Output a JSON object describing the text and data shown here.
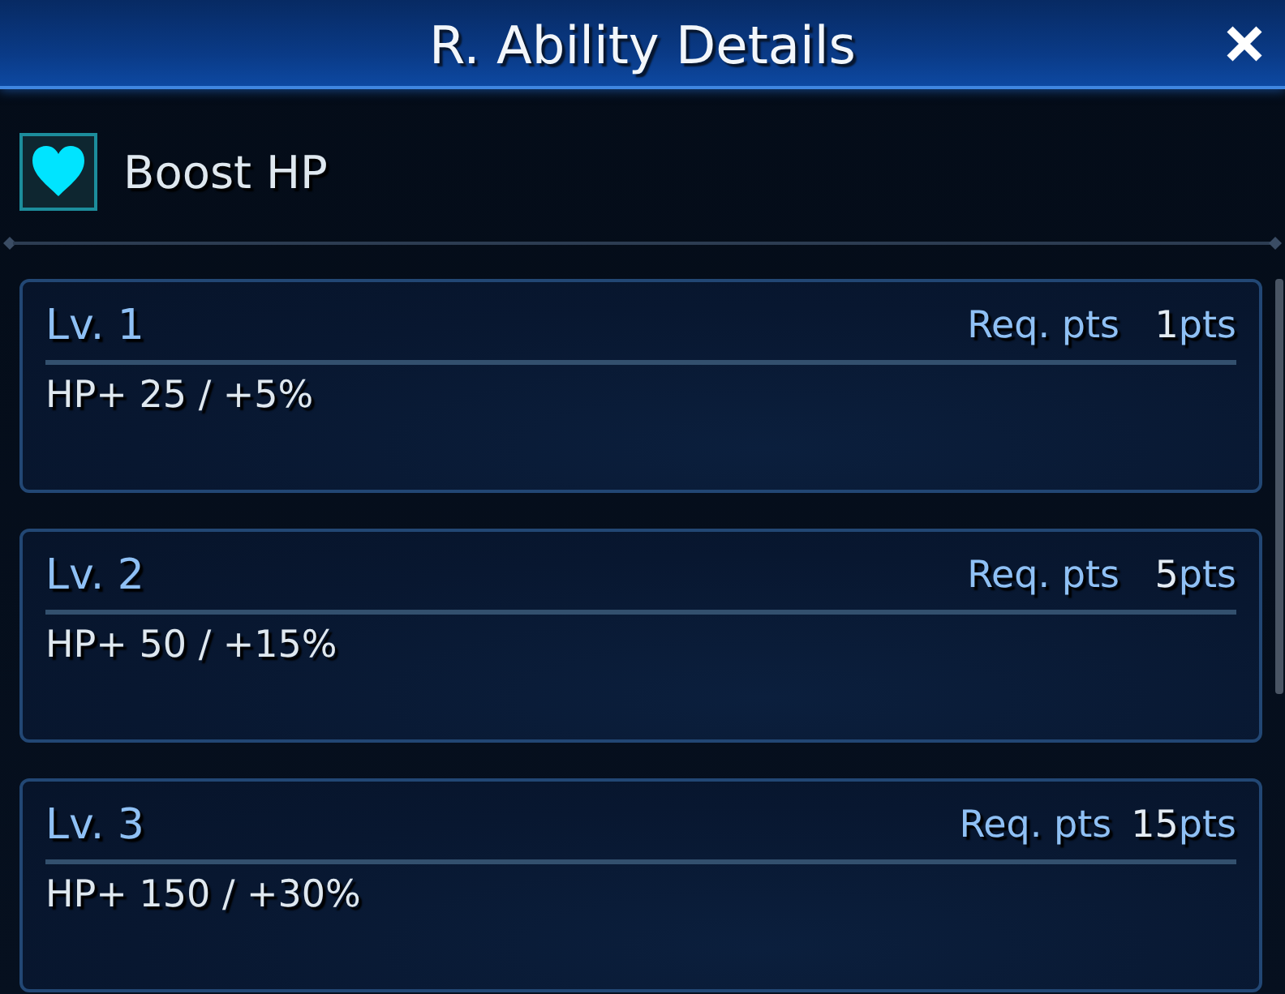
{
  "window": {
    "title": "R. Ability Details"
  },
  "ability": {
    "name": "Boost HP"
  },
  "levels": [
    {
      "level": "Lv. 1",
      "req_label": "Req. pts",
      "points": "1",
      "unit": "pts",
      "effect": "HP+ 25 / +5%"
    },
    {
      "level": "Lv. 2",
      "req_label": "Req. pts",
      "points": "5",
      "unit": "pts",
      "effect": "HP+ 50 / +15%"
    },
    {
      "level": "Lv. 3",
      "req_label": "Req. pts",
      "points": "15",
      "unit": "pts",
      "effect": "HP+ 150 / +30%"
    }
  ]
}
